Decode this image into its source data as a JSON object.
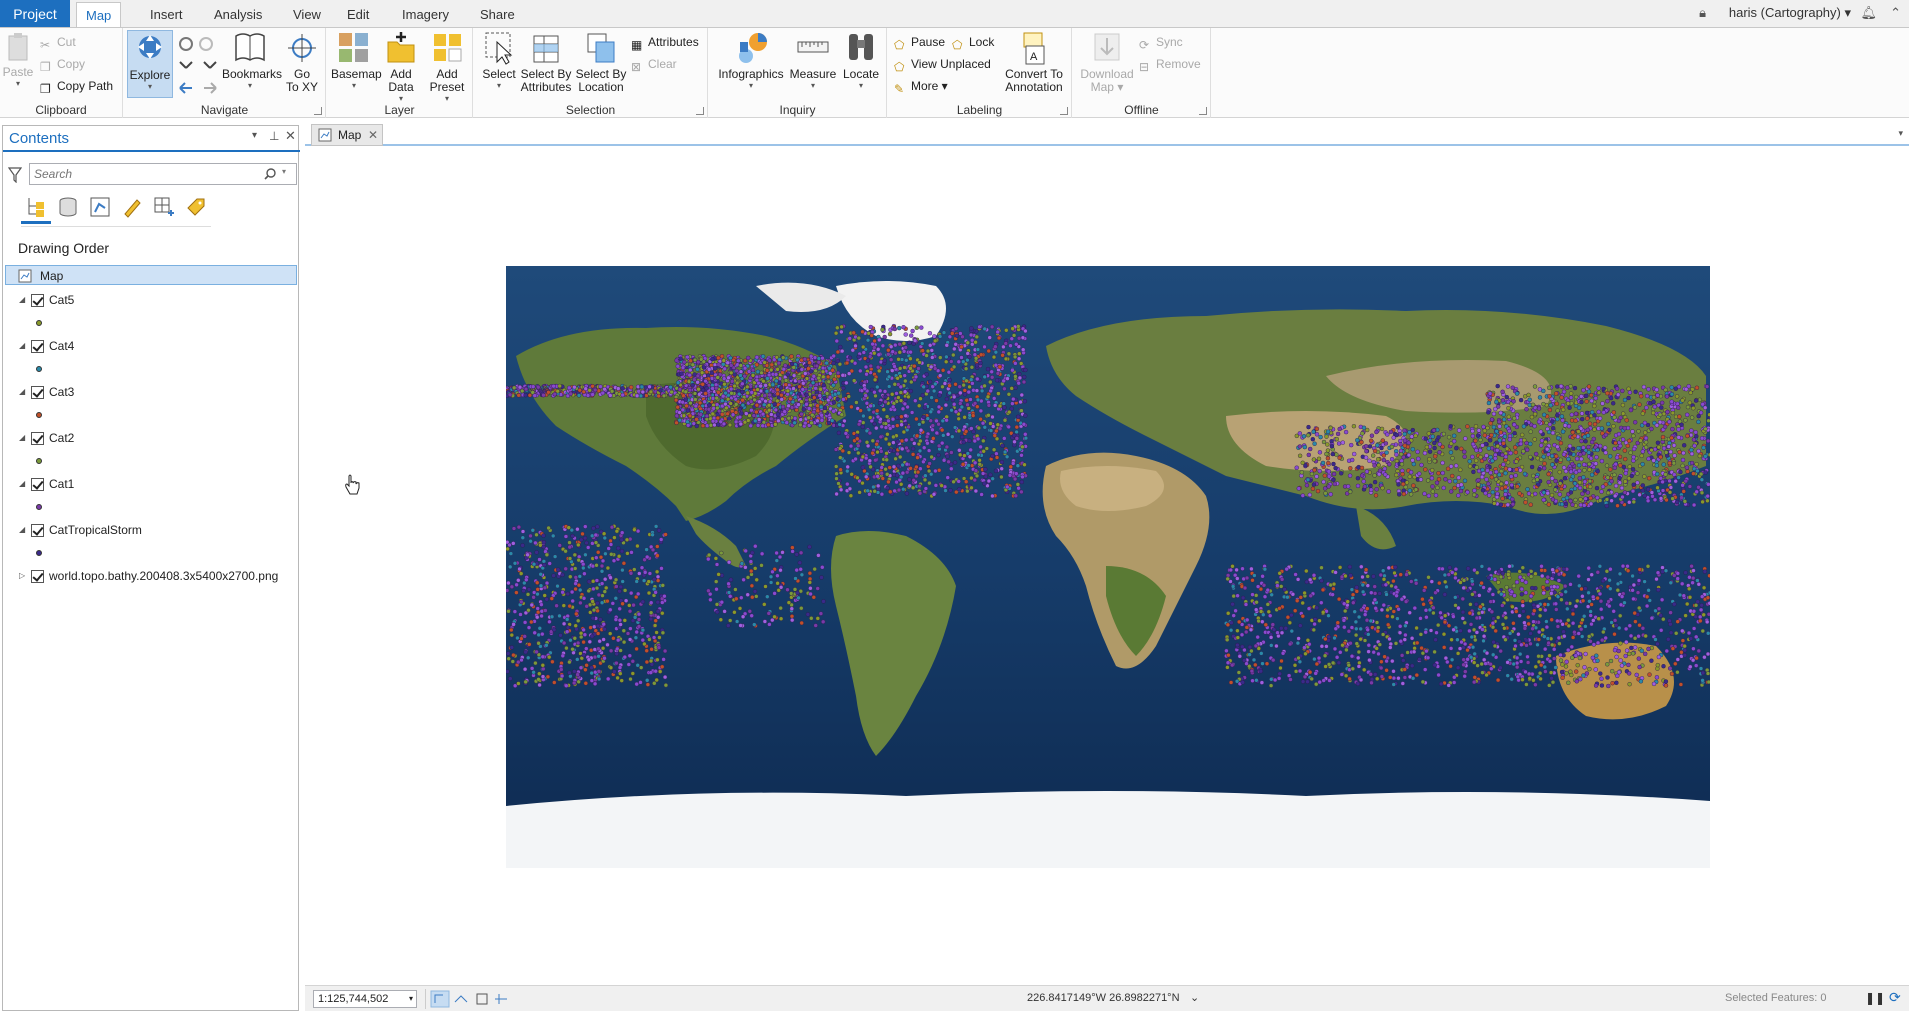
{
  "tabs": {
    "project": "Project",
    "items": [
      "Map",
      "Insert",
      "Analysis",
      "View",
      "Edit",
      "Imagery",
      "Share"
    ],
    "active": "Map"
  },
  "user": "haris (Cartography) ▾",
  "ribbon": {
    "clipboard": {
      "label": "Clipboard",
      "paste": "Paste",
      "cut": "Cut",
      "copy": "Copy",
      "copy_path": "Copy Path"
    },
    "navigate": {
      "label": "Navigate",
      "explore": "Explore",
      "bookmarks": "Bookmarks",
      "goto_line1": "Go",
      "goto_line2": "To XY"
    },
    "layer": {
      "label": "Layer",
      "basemap": "Basemap",
      "add_data_1": "Add",
      "add_data_2": "Data",
      "add_preset_1": "Add",
      "add_preset_2": "Preset"
    },
    "selection": {
      "label": "Selection",
      "select": "Select",
      "sba_1": "Select By",
      "sba_2": "Attributes",
      "sbl_1": "Select By",
      "sbl_2": "Location",
      "attributes": "Attributes",
      "clear": "Clear"
    },
    "inquiry": {
      "label": "Inquiry",
      "infographics": "Infographics",
      "measure": "Measure",
      "locate": "Locate"
    },
    "labeling": {
      "label": "Labeling",
      "pause": "Pause",
      "lock": "Lock",
      "view_unplaced": "View Unplaced",
      "more": "More",
      "convert_1": "Convert To",
      "convert_2": "Annotation"
    },
    "offline": {
      "label": "Offline",
      "download_1": "Download",
      "download_2": "Map",
      "sync": "Sync",
      "remove": "Remove"
    }
  },
  "contents": {
    "title": "Contents",
    "search_placeholder": "Search",
    "heading": "Drawing Order",
    "map_item": "Map",
    "layers": [
      {
        "name": "Cat5",
        "color": "#8a9a2a"
      },
      {
        "name": "Cat4",
        "color": "#2a8aa8"
      },
      {
        "name": "Cat3",
        "color": "#c0502a"
      },
      {
        "name": "Cat2",
        "color": "#7a9a3a"
      },
      {
        "name": "Cat1",
        "color": "#7a3aa8"
      },
      {
        "name": "CatTropicalStorm",
        "color": "#3a2a8a"
      }
    ],
    "basemap_layer": "world.topo.bathy.200408.3x5400x2700.png"
  },
  "map_tab": "Map",
  "status": {
    "scale": "1:125,744,502",
    "coords": "226.8417149°W 26.8982271°N",
    "selected_features": "Selected Features: 0"
  }
}
